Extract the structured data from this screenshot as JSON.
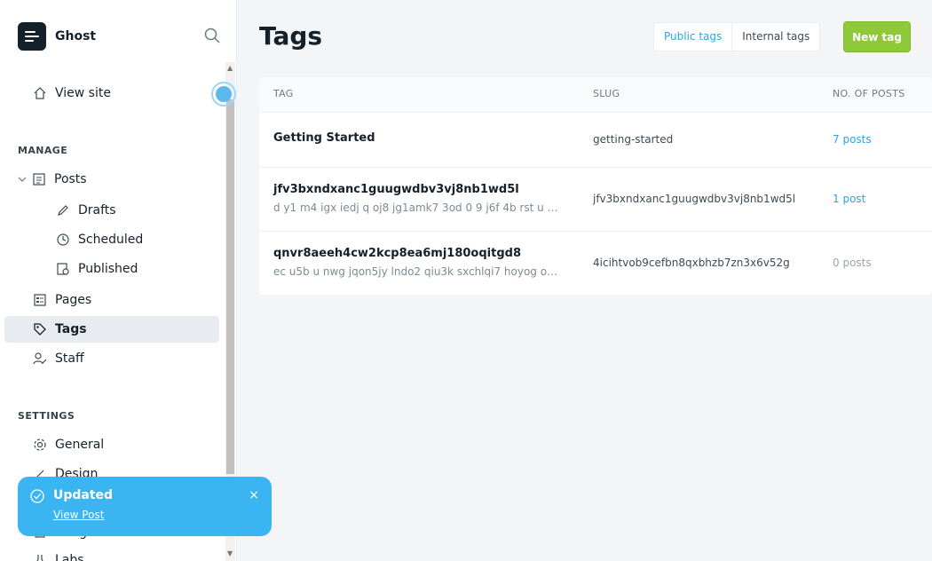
{
  "brand": "Ghost",
  "sidebar": {
    "view_site": "View site",
    "manage_label": "MANAGE",
    "posts": "Posts",
    "drafts": "Drafts",
    "scheduled": "Scheduled",
    "published": "Published",
    "pages": "Pages",
    "tags": "Tags",
    "staff": "Staff",
    "settings_label": "SETTINGS",
    "general": "General",
    "design": "Design",
    "integrations": "Integrations",
    "labs": "Labs"
  },
  "main": {
    "title": "Tags",
    "tabs": [
      "Public tags",
      "Internal tags"
    ],
    "new_tag": "New tag",
    "columns": [
      "TAG",
      "SLUG",
      "NO. OF POSTS"
    ],
    "rows": [
      {
        "name": "Getting Started",
        "desc": "",
        "slug": "getting-started",
        "count": "7 posts"
      },
      {
        "name": "jfv3bxndxanc1guugwdbv3vj8nb1wd5l",
        "desc": "d y1 m4 igx iedj q oj8 jg1amk7 3od 0 9 j6f 4b rst u …",
        "slug": "jfv3bxndxanc1guugwdbv3vj8nb1wd5l",
        "count": "1 post"
      },
      {
        "name": "qnvr8aeeh4cw2kcp8ea6mj180oqitgd8",
        "desc": "ec u5b u nwg jqon5jy lndo2 qiu3k sxchlqi7 hoyog o…",
        "slug": "4icihtvob9cefbn8qxbhzb7zn3x6v52g",
        "count": "0 posts"
      }
    ]
  },
  "toast": {
    "title": "Updated",
    "link": "View Post",
    "close": "×"
  },
  "colors": {
    "accent": "#30a4e0",
    "primary_button": "#8fc93a",
    "toast": "#3ab5f1"
  }
}
